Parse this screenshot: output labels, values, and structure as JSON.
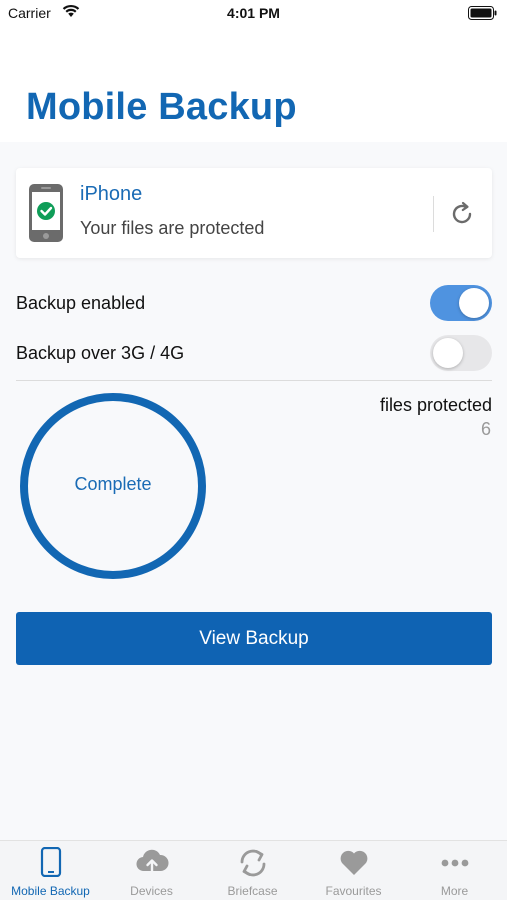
{
  "status_bar": {
    "carrier": "Carrier",
    "time": "4:01 PM"
  },
  "header": {
    "title": "Mobile Backup"
  },
  "device": {
    "name": "iPhone",
    "status": "Your files are protected"
  },
  "settings": [
    {
      "label": "Backup enabled",
      "enabled": true
    },
    {
      "label": "Backup over 3G / 4G",
      "enabled": false
    }
  ],
  "progress": {
    "label": "Complete",
    "fraction": 1.0
  },
  "files": {
    "label": "files protected",
    "count": "6"
  },
  "actions": {
    "view_backup": "View Backup"
  },
  "tabs": [
    {
      "label": "Mobile Backup",
      "icon": "phone-icon",
      "active": true
    },
    {
      "label": "Devices",
      "icon": "cloud-upload-icon",
      "active": false
    },
    {
      "label": "Briefcase",
      "icon": "sync-icon",
      "active": false
    },
    {
      "label": "Favourites",
      "icon": "heart-icon",
      "active": false
    },
    {
      "label": "More",
      "icon": "more-icon",
      "active": false
    }
  ],
  "colors": {
    "accent": "#1267b3",
    "toggle_on": "#4f93e0",
    "success": "#0f9d58",
    "inactive": "#9a9a9a"
  }
}
